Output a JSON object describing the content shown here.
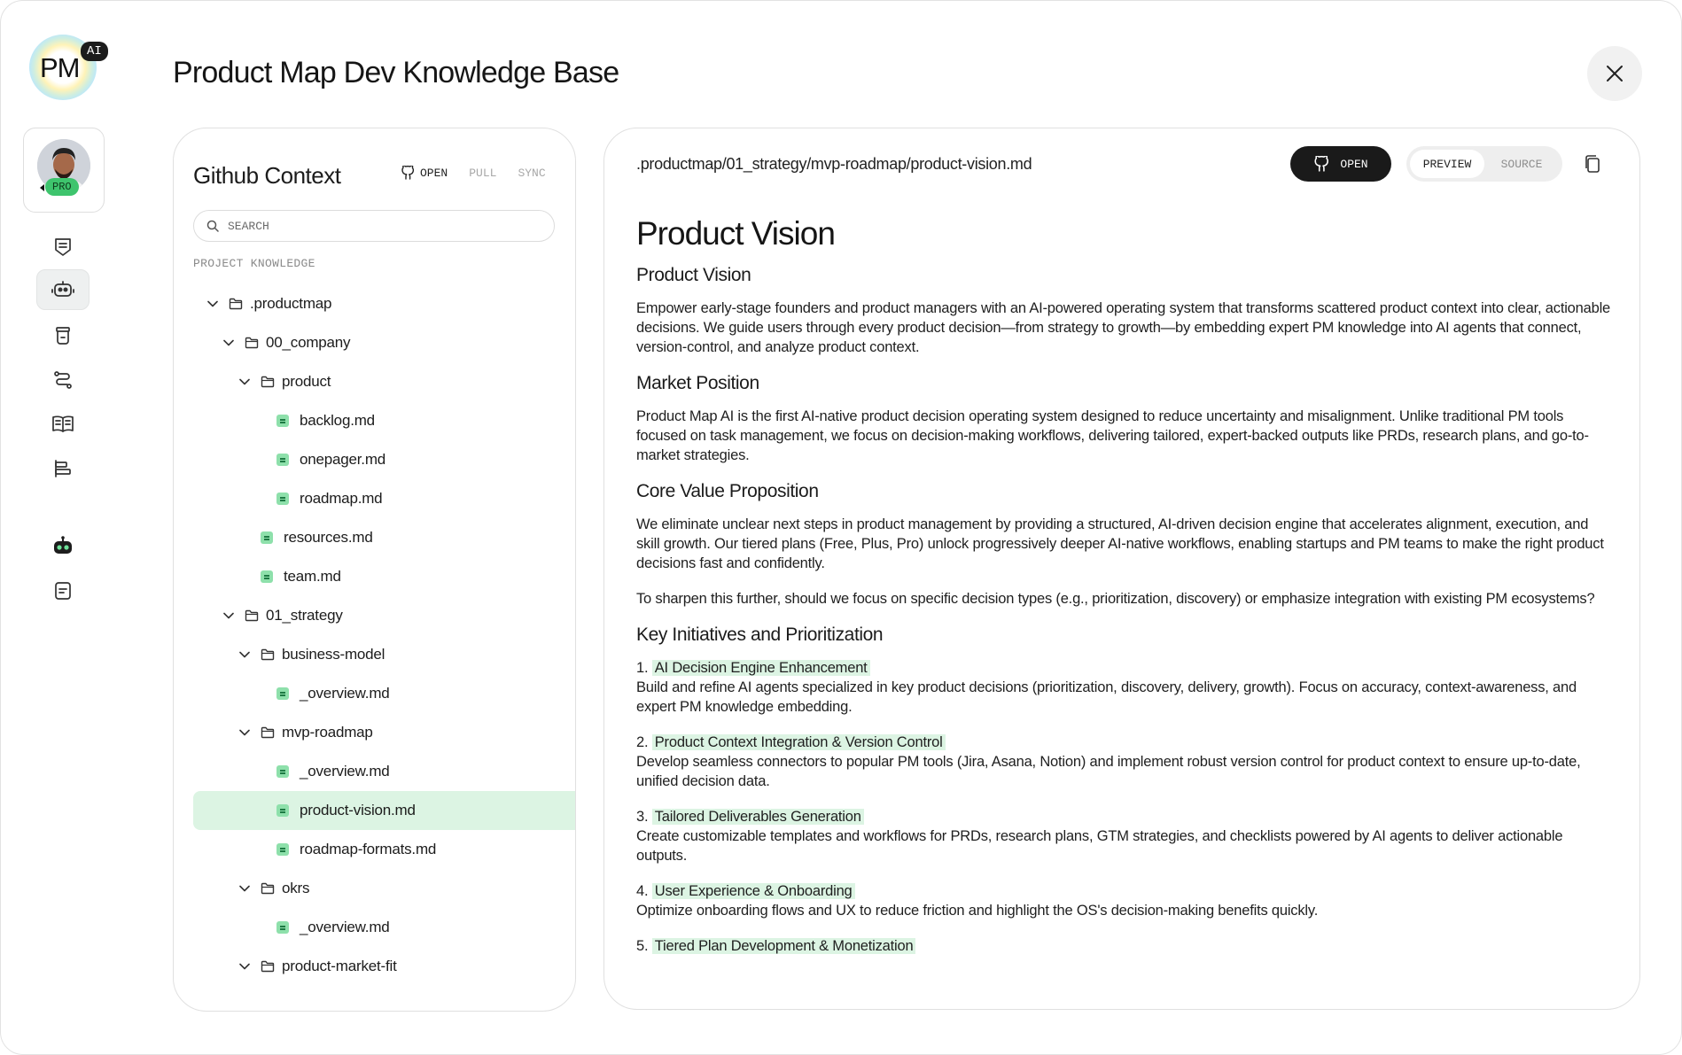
{
  "app": {
    "logo_text": "PM",
    "logo_badge": "AI",
    "title": "Product Map Dev Knowledge Base"
  },
  "rail": {
    "plan_badge": "PRO",
    "icons": [
      "shield-list-icon",
      "robot-icon",
      "jar-icon",
      "route-icon",
      "book-icon",
      "roadmap-icon",
      "bot-face-icon",
      "note-icon"
    ]
  },
  "github": {
    "title": "Github Context",
    "open_label": "OPEN",
    "pull_label": "PULL",
    "sync_label": "SYNC",
    "search_placeholder": "SEARCH",
    "section_label": "PROJECT KNOWLEDGE",
    "tree": [
      {
        "label": ".productmap",
        "type": "folder",
        "depth": 0
      },
      {
        "label": "00_company",
        "type": "folder",
        "depth": 1
      },
      {
        "label": "product",
        "type": "folder",
        "depth": 2
      },
      {
        "label": "backlog.md",
        "type": "file",
        "depth": 3
      },
      {
        "label": "onepager.md",
        "type": "file",
        "depth": 3
      },
      {
        "label": "roadmap.md",
        "type": "file",
        "depth": 3
      },
      {
        "label": "resources.md",
        "type": "file",
        "depth": 2
      },
      {
        "label": "team.md",
        "type": "file",
        "depth": 2
      },
      {
        "label": "01_strategy",
        "type": "folder",
        "depth": 1
      },
      {
        "label": "business-model",
        "type": "folder",
        "depth": 2
      },
      {
        "label": "_overview.md",
        "type": "file",
        "depth": 3
      },
      {
        "label": "mvp-roadmap",
        "type": "folder",
        "depth": 2
      },
      {
        "label": "_overview.md",
        "type": "file",
        "depth": 3
      },
      {
        "label": "product-vision.md",
        "type": "file",
        "depth": 3,
        "selected": true
      },
      {
        "label": "roadmap-formats.md",
        "type": "file",
        "depth": 3
      },
      {
        "label": "okrs",
        "type": "folder",
        "depth": 2
      },
      {
        "label": "_overview.md",
        "type": "file",
        "depth": 3
      },
      {
        "label": "product-market-fit",
        "type": "folder",
        "depth": 2
      }
    ]
  },
  "doc": {
    "path": ".productmap/01_strategy/mvp-roadmap/product-vision.md",
    "open_label": "OPEN",
    "preview_label": "PREVIEW",
    "source_label": "SOURCE",
    "h1": "Product Vision",
    "s1_title": "Product Vision",
    "s1_p": "Empower early-stage founders and product managers with an AI-powered operating system that transforms scattered product context into clear, actionable decisions. We guide users through every product decision—from strategy to growth—by embedding expert PM knowledge into AI agents that connect, version-control, and analyze product context.",
    "s2_title": "Market Position",
    "s2_p": "Product Map AI is the first AI-native product decision operating system designed to reduce uncertainty and misalignment. Unlike traditional PM tools focused on task management, we focus on decision-making workflows, delivering tailored, expert-backed outputs like PRDs, research plans, and go-to-market strategies.",
    "s3_title": "Core Value Proposition",
    "s3_p1": "We eliminate unclear next steps in product management by providing a structured, AI-driven decision engine that accelerates alignment, execution, and skill growth. Our tiered plans (Free, Plus, Pro) unlock progressively deeper AI-native workflows, enabling startups and PM teams to make the right product decisions fast and confidently.",
    "s3_p2": "To sharpen this further, should we focus on specific decision types (e.g., prioritization, discovery) or emphasize integration with existing PM ecosystems?",
    "s4_title": "Key Initiatives and Prioritization",
    "initiatives": [
      {
        "num": "1.",
        "title": "AI Decision Engine Enhancement",
        "desc": "Build and refine AI agents specialized in key product decisions (prioritization, discovery, delivery, growth). Focus on accuracy, context-awareness, and expert PM knowledge embedding."
      },
      {
        "num": "2.",
        "title": "Product Context Integration & Version Control",
        "desc": "Develop seamless connectors to popular PM tools (Jira, Asana, Notion) and implement robust version control for product context to ensure up-to-date, unified decision data."
      },
      {
        "num": "3.",
        "title": "Tailored Deliverables Generation",
        "desc": "Create customizable templates and workflows for PRDs, research plans, GTM strategies, and checklists powered by AI agents to deliver actionable outputs."
      },
      {
        "num": "4.",
        "title": "User Experience & Onboarding",
        "desc": "Optimize onboarding flows and UX to reduce friction and highlight the OS's decision-making benefits quickly."
      },
      {
        "num": "5.",
        "title": "Tiered Plan Development & Monetization",
        "desc": ""
      }
    ]
  }
}
